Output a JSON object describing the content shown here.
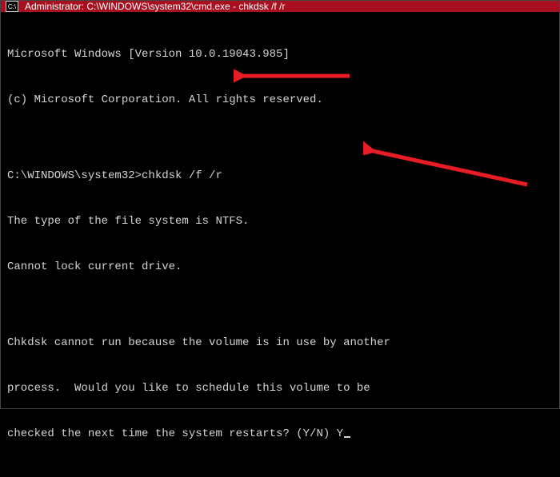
{
  "titlebar": {
    "icon_label": "cmd",
    "title": "Administrator: C:\\WINDOWS\\system32\\cmd.exe - chkdsk  /f /r"
  },
  "terminal": {
    "line1": "Microsoft Windows [Version 10.0.19043.985]",
    "line2": "(c) Microsoft Corporation. All rights reserved.",
    "blank1": "",
    "prompt": "C:\\WINDOWS\\system32>",
    "command": "chkdsk /f /r",
    "line4": "The type of the file system is NTFS.",
    "line5": "Cannot lock current drive.",
    "blank2": "",
    "line6": "Chkdsk cannot run because the volume is in use by another",
    "line7": "process.  Would you like to schedule this volume to be",
    "line8_part": "checked the next time the system restarts? (Y/N) ",
    "user_input": "Y"
  },
  "annotations": {
    "arrow_color": "#e81c25"
  }
}
